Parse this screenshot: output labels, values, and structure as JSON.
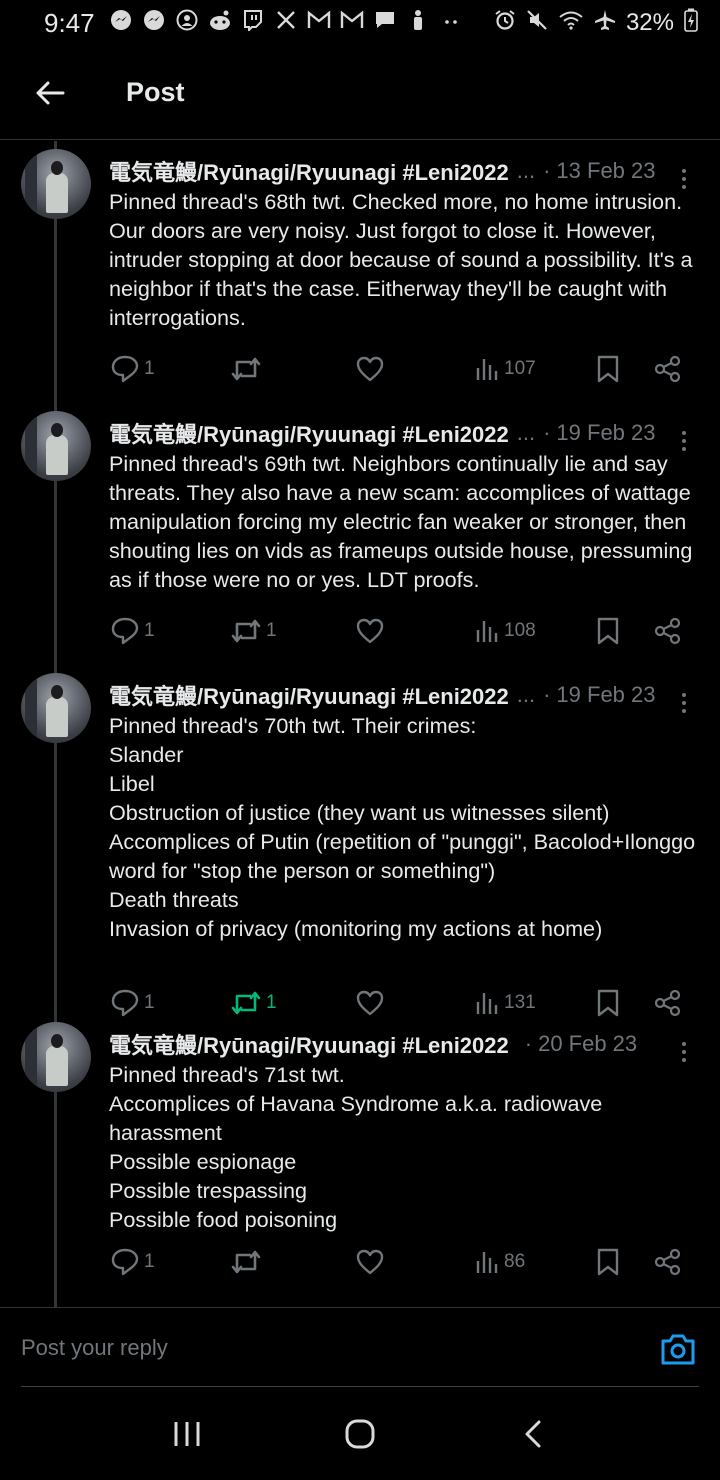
{
  "status_bar": {
    "time": "9:47",
    "notification_icons": [
      "messenger-icon",
      "messenger-icon",
      "account-icon",
      "reddit-icon",
      "twitch-icon",
      "x-icon",
      "gmail-icon",
      "gmail-icon",
      "chat-icon",
      "person-icon",
      "more-dots-icon"
    ],
    "battery": "32%"
  },
  "header": {
    "title": "Post"
  },
  "author_name": "電気竜鰻/Ryūnagi/Ryuunagi #Leni2022",
  "tweets": [
    {
      "ellipsis": "...",
      "date": "13 Feb 23",
      "text": "Pinned thread's 68th twt. Checked more, no home intrusion. Our doors are very noisy. Just forgot to close it. However, intruder stopping at door because of sound a possibility. It's a neighbor if that's the case. Eitherway they'll be caught with interrogations.",
      "replies": "1",
      "retweets": "",
      "views": "107",
      "retweeted": false
    },
    {
      "ellipsis": "...",
      "date": "19 Feb 23",
      "text": "Pinned thread's 69th twt. Neighbors continually lie and say threats. They also have a new scam: accomplices of wattage manipulation forcing my electric fan weaker or stronger, then shouting lies on vids as frameups outside house, pressuming as if those were no or yes. LDT proofs.",
      "replies": "1",
      "retweets": "1",
      "views": "108",
      "retweeted": false
    },
    {
      "ellipsis": "...",
      "date": "19 Feb 23",
      "text": "Pinned thread's 70th twt. Their crimes:\nSlander\nLibel\nObstruction of justice (they want us witnesses silent)\nAccomplices of Putin (repetition of \"punggi\", Bacolod+Ilonggo word for \"stop the person or something\")\nDeath threats\nInvasion of privacy (monitoring my actions at home)",
      "replies": "1",
      "retweets": "1",
      "views": "131",
      "retweeted": true
    },
    {
      "ellipsis": "",
      "date": "20 Feb 23",
      "text": "Pinned thread's 71st twt.\nAccomplices of Havana Syndrome a.k.a. radiowave harassment\nPossible espionage\nPossible trespassing\nPossible food poisoning",
      "replies": "1",
      "retweets": "",
      "views": "86",
      "retweeted": false
    }
  ],
  "reply_bar": {
    "placeholder": "Post your reply"
  },
  "colors": {
    "accent": "#1d9bf0",
    "retweet_green": "#00ba7c",
    "muted": "#71767b",
    "text": "#e7e9ea",
    "background": "#000000"
  }
}
